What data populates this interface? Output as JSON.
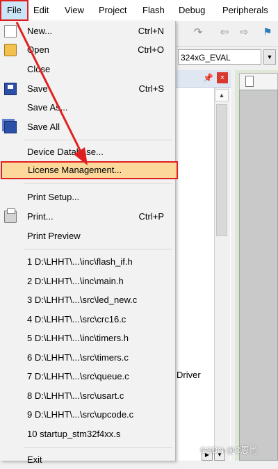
{
  "menubar": {
    "items": [
      "File",
      "Edit",
      "View",
      "Project",
      "Flash",
      "Debug",
      "Peripherals"
    ]
  },
  "toolbar": {
    "target_name": "324xG_EVAL"
  },
  "background": {
    "driver_text": "Driver",
    "watermark": "CSDN @C恩尚"
  },
  "file_menu": {
    "new": {
      "label": "New...",
      "shortcut": "Ctrl+N"
    },
    "open": {
      "label": "Open",
      "shortcut": "Ctrl+O"
    },
    "close": {
      "label": "Close"
    },
    "save": {
      "label": "Save",
      "shortcut": "Ctrl+S"
    },
    "save_as": {
      "label": "Save As..."
    },
    "save_all": {
      "label": "Save All"
    },
    "device_database": {
      "label": "Device Database..."
    },
    "license_management": {
      "label": "License Management..."
    },
    "print_setup": {
      "label": "Print Setup..."
    },
    "print": {
      "label": "Print...",
      "shortcut": "Ctrl+P"
    },
    "print_preview": {
      "label": "Print Preview"
    },
    "recent_files": [
      "1 D:\\LHHT\\...\\inc\\flash_if.h",
      "2 D:\\LHHT\\...\\inc\\main.h",
      "3 D:\\LHHT\\...\\src\\led_new.c",
      "4 D:\\LHHT\\...\\src\\crc16.c",
      "5 D:\\LHHT\\...\\inc\\timers.h",
      "6 D:\\LHHT\\...\\src\\timers.c",
      "7 D:\\LHHT\\...\\src\\queue.c",
      "8 D:\\LHHT\\...\\src\\usart.c",
      "9 D:\\LHHT\\...\\src\\upcode.c",
      "10 startup_stm32f4xx.s"
    ],
    "exit": {
      "label": "Exit"
    }
  },
  "colors": {
    "highlight_fill": "#fcd99a",
    "annotation_red": "#e02020",
    "menu_bg": "#f2f2f2"
  }
}
